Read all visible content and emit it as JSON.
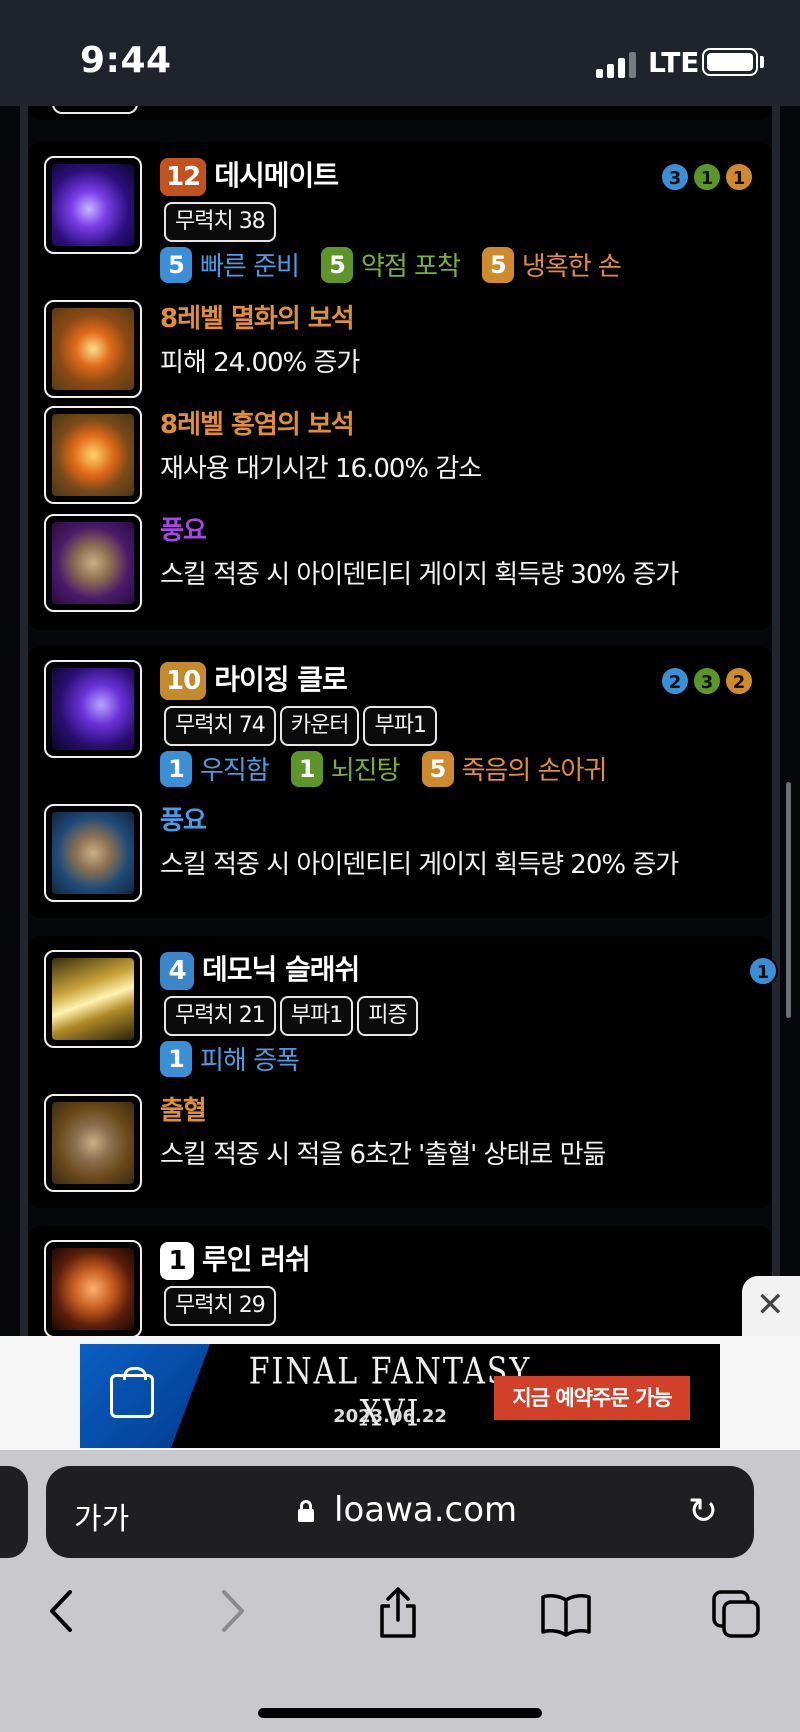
{
  "status_bar": {
    "time": "9:44",
    "network": "LTE"
  },
  "cards": [
    {
      "level": "12",
      "name": "데시메이트",
      "tags": [
        "무력치 38"
      ],
      "tripods": [
        {
          "num": "5",
          "name": "빠른 준비",
          "color": "blue"
        },
        {
          "num": "5",
          "name": "약점 포착",
          "color": "green"
        },
        {
          "num": "5",
          "name": "냉혹한 손",
          "color": "orange"
        }
      ],
      "tripod_levels": [
        "3",
        "1",
        "1"
      ],
      "gems": [
        {
          "title": "8레벨 멸화의 보석",
          "desc": "피해 24.00% 증가"
        },
        {
          "title": "8레벨 홍염의 보석",
          "desc": "재사용 대기시간 16.00% 감소"
        }
      ],
      "rune": {
        "name": "풍요",
        "desc": "스킬 적중 시 아이덴티티 게이지 획득량 30% 증가",
        "color": "#a648e0"
      }
    },
    {
      "level": "10",
      "name": "라이징 클로",
      "tags": [
        "무력치 74",
        "카운터",
        "부파1"
      ],
      "tripods": [
        {
          "num": "1",
          "name": "우직함",
          "color": "blue"
        },
        {
          "num": "1",
          "name": "뇌진탕",
          "color": "green"
        },
        {
          "num": "5",
          "name": "죽음의 손아귀",
          "color": "orange"
        }
      ],
      "tripod_levels": [
        "2",
        "3",
        "2"
      ],
      "rune": {
        "name": "풍요",
        "desc": "스킬 적중 시 아이덴티티 게이지 획득량 20% 증가",
        "color": "#4a9de2"
      }
    },
    {
      "level": "4",
      "name": "데모닉 슬래쉬",
      "tags": [
        "무력치 21",
        "부파1",
        "피증"
      ],
      "tripods": [
        {
          "num": "1",
          "name": "피해 증폭",
          "color": "blue"
        }
      ],
      "tripod_levels": [
        "1"
      ],
      "rune": {
        "name": "출혈",
        "desc": "스킬 적중 시 적을 6초간 '출혈' 상태로 만듦",
        "color": "#e08f36"
      }
    },
    {
      "level": "1",
      "name": "루인 러쉬",
      "tags": [
        "무력치 29"
      ]
    }
  ],
  "ad": {
    "title": "FINAL FANTASY XVI",
    "date": "2023.06.22",
    "cta": "지금 예약주문 가능",
    "close": "✕"
  },
  "browser": {
    "text_size_button": "가가",
    "url": "loawa.com"
  },
  "colors": {
    "blue": "#3a8fd6",
    "green": "#5c9628",
    "orange": "#cf8a2e",
    "gem_gold": "#e08f36",
    "rune_purple": "#a648e0"
  }
}
